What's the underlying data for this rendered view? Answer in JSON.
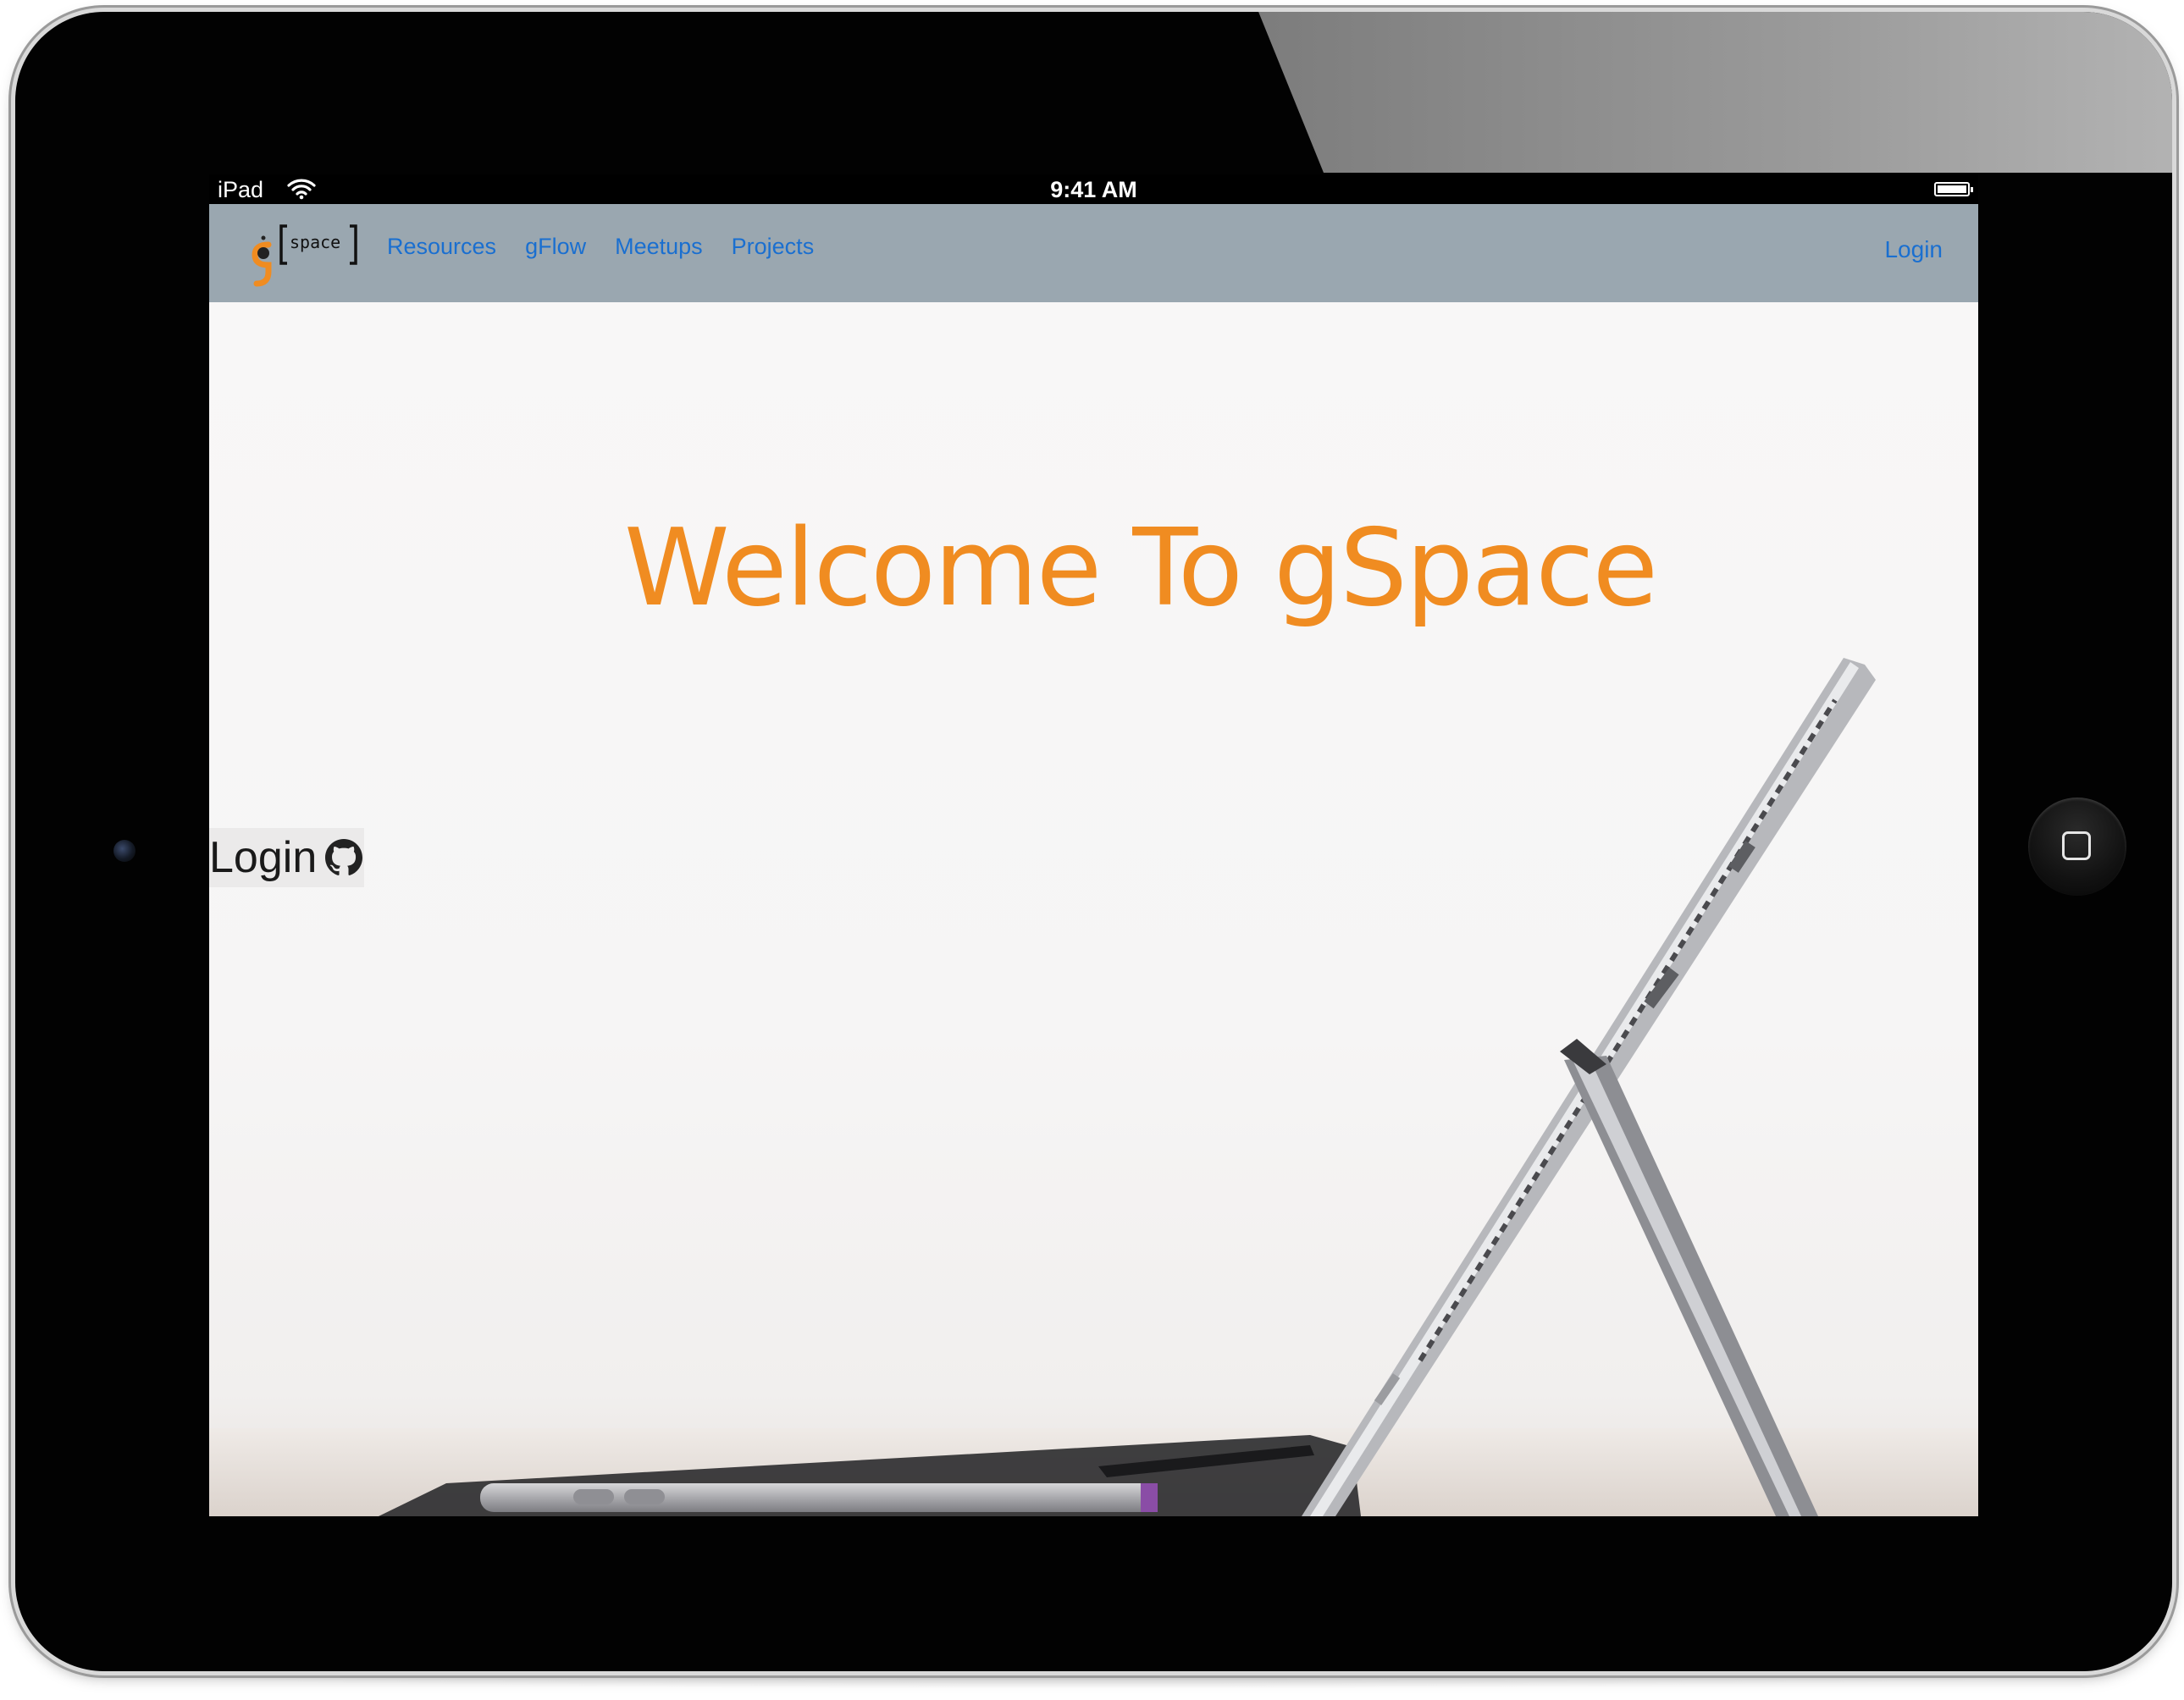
{
  "device": {
    "status_bar": {
      "carrier": "iPad",
      "time": "9:41 AM"
    }
  },
  "navbar": {
    "logo_text": "space",
    "links": [
      {
        "label": "Resources"
      },
      {
        "label": "gFlow"
      },
      {
        "label": "Meetups"
      },
      {
        "label": "Projects"
      }
    ],
    "login_label": "Login"
  },
  "hero": {
    "title": "Welcome To gSpace",
    "login_button_label": "Login"
  },
  "colors": {
    "navbar_bg": "#9aa7b0",
    "link": "#1a6fd0",
    "accent_orange": "#f08c21"
  },
  "icons": {
    "login_button": "github-icon",
    "status_bar": [
      "wifi-icon",
      "battery-icon"
    ]
  }
}
